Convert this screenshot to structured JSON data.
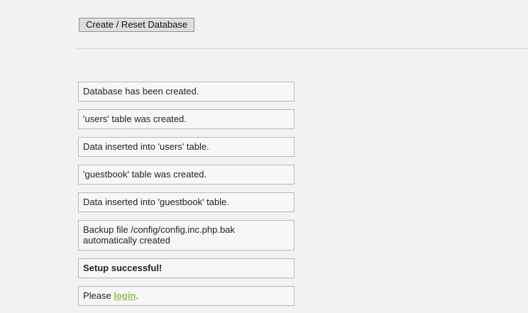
{
  "toolbar": {
    "reset_label": "Create / Reset Database"
  },
  "messages": {
    "m1": "Database has been created.",
    "m2": "'users' table was created.",
    "m3": "Data inserted into 'users' table.",
    "m4": "'guestbook' table was created.",
    "m5": "Data inserted into 'guestbook' table.",
    "m6": "Backup file /config/config.inc.php.bak automatically created",
    "m7": "Setup successful!",
    "m8_prefix": "Please ",
    "m8_link": "login",
    "m8_suffix": "."
  },
  "colors": {
    "background": "#f2f2f2",
    "link": "#8cc63e",
    "divider": "#c9d4e8"
  }
}
